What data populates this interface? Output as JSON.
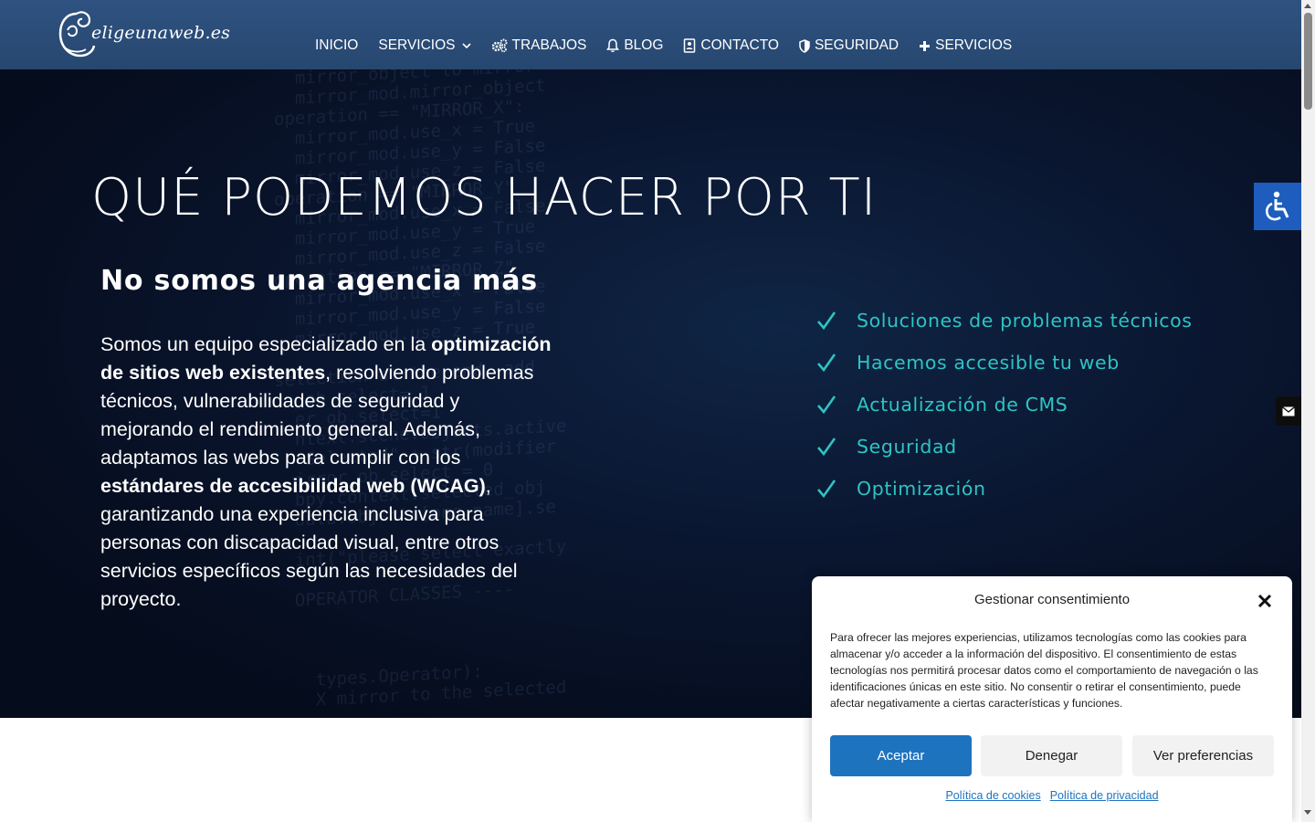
{
  "brand": {
    "logo_text": "eligeunaweb.es"
  },
  "nav": {
    "items": [
      {
        "label": "INICIO",
        "icon": ""
      },
      {
        "label": "SERVICIOS",
        "icon": "chevron-down-icon"
      },
      {
        "label": "TRABAJOS",
        "icon": "gears-icon"
      },
      {
        "label": "BLOG",
        "icon": "bell-icon"
      },
      {
        "label": "CONTACTO",
        "icon": "contact-card-icon"
      },
      {
        "label": "SEGURIDAD",
        "icon": "shield-icon"
      },
      {
        "label": "SERVICIOS",
        "icon": "plus-icon"
      }
    ]
  },
  "hero": {
    "title": "QUÉ PODEMOS HACER POR TI",
    "subtitle": "No somos una agencia más",
    "body": {
      "p1": "Somos un equipo especializado en la ",
      "b1": "optimización de sitios web existentes",
      "p2": ", resolviendo problemas técnicos, vulnerabilidades de seguridad y mejorando el rendimiento general. Además, adaptamos las webs para cumplir con los ",
      "b2": "estándares de accesibilidad web (WCAG)",
      "p3": ", garantizando una experiencia inclusiva para personas con discapacidad visual, entre otros servicios específicos según las necesidades del proyecto."
    },
    "features": [
      "Soluciones de problemas técnicos",
      "Hacemos accesible tu web",
      "Actualización de CMS",
      "Seguridad",
      "Optimización"
    ]
  },
  "consent": {
    "title": "Gestionar consentimiento",
    "text": "Para ofrecer las mejores experiencias, utilizamos tecnologías como las cookies para almacenar y/o acceder a la información del dispositivo. El consentimiento de estas tecnologías nos permitirá procesar datos como el comportamiento de navegación o las identificaciones únicas en este sitio. No consentir o retirar el consentimiento, puede afectar negativamente a ciertas características y funciones.",
    "accept_label": "Aceptar",
    "deny_label": "Denegar",
    "prefs_label": "Ver preferencias",
    "cookie_policy_label": "Política de cookies",
    "privacy_policy_label": "Política de privacidad"
  },
  "colors": {
    "header": "#2f5281",
    "accent_teal": "#2ec4c4",
    "accept_button": "#1e73be",
    "a11y_button": "#1e5dbd"
  }
}
